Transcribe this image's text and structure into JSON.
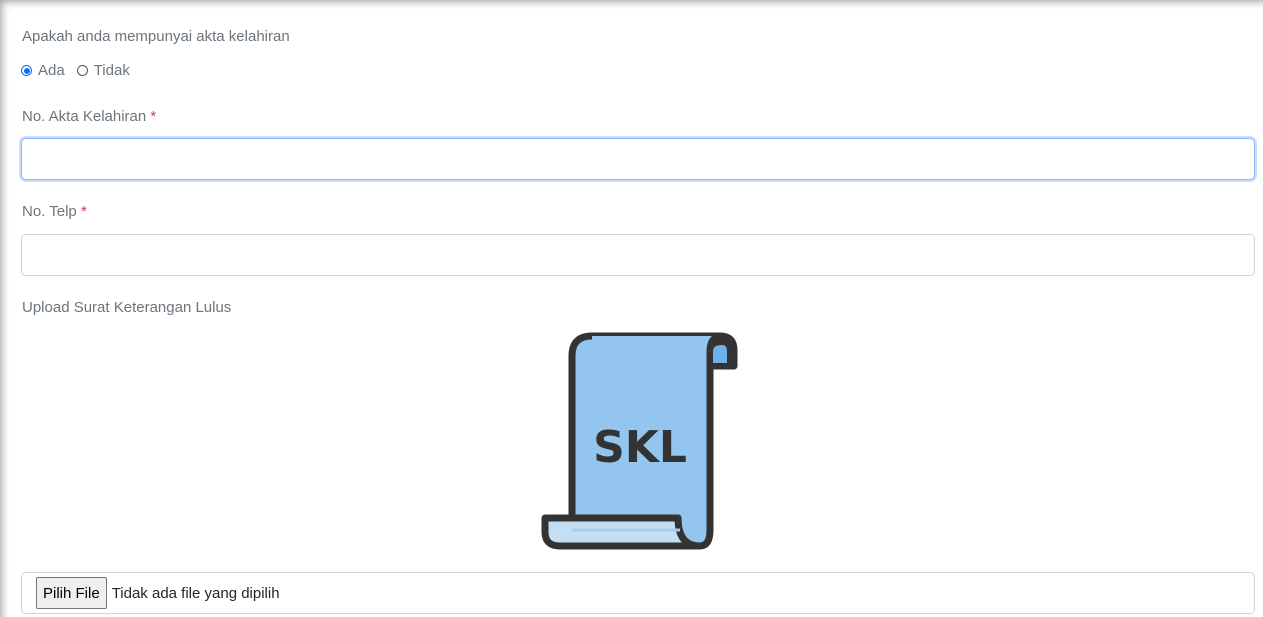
{
  "birth_certificate_question": {
    "label": "Apakah anda mempunyai akta kelahiran",
    "options": [
      {
        "label": "Ada",
        "checked": true
      },
      {
        "label": "Tidak",
        "checked": false
      }
    ]
  },
  "birth_certificate_number": {
    "label": "No. Akta Kelahiran",
    "required_mark": "*",
    "value": "",
    "placeholder": ""
  },
  "phone": {
    "label": "No. Telp",
    "required_mark": "*",
    "value": "",
    "placeholder": ""
  },
  "upload_skl": {
    "label": "Upload Surat Keterangan Lulus",
    "illustration_text": "SKL",
    "illustration_icon": "scroll-document-icon",
    "button_label": "Pilih File",
    "status_text": "Tidak ada file yang dipilih"
  },
  "colors": {
    "accent": "#0d6efd",
    "required": "#dc3545",
    "scroll_fill": "#93c5ee",
    "scroll_stroke": "#333333"
  }
}
